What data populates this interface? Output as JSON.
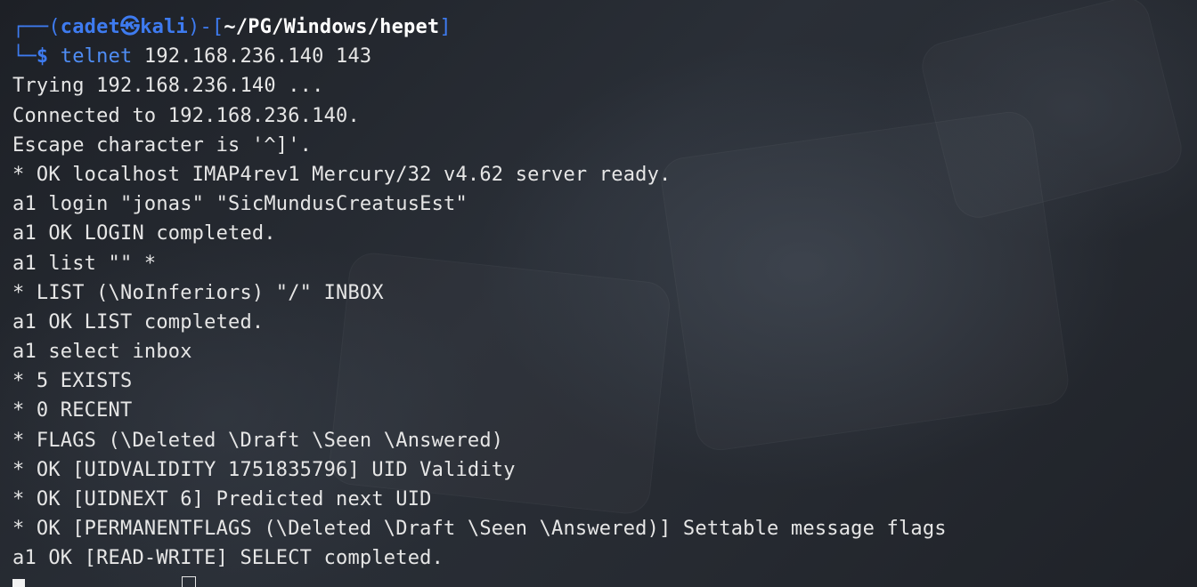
{
  "prompt": {
    "box_top": "┌──(",
    "user": "cadet",
    "at_icon": "㉿",
    "host": "kali",
    "mid": ")-[",
    "path": "~/PG/Windows/hepet",
    "close": "]",
    "box_bottom": "└─",
    "dollar": "$"
  },
  "command": {
    "name": "telnet",
    "args": " 192.168.236.140 143"
  },
  "output": [
    "Trying 192.168.236.140 ...",
    "Connected to 192.168.236.140.",
    "Escape character is '^]'.",
    "* OK localhost IMAP4rev1 Mercury/32 v4.62 server ready.",
    "a1 login \"jonas\" \"SicMundusCreatusEst\"",
    "a1 OK LOGIN completed.",
    "a1 list \"\" *",
    "* LIST (\\NoInferiors) \"/\" INBOX",
    "a1 OK LIST completed.",
    "a1 select inbox",
    "* 5 EXISTS",
    "* 0 RECENT",
    "* FLAGS (\\Deleted \\Draft \\Seen \\Answered)",
    "* OK [UIDVALIDITY 1751835796] UID Validity",
    "* OK [UIDNEXT 6] Predicted next UID",
    "* OK [PERMANENTFLAGS (\\Deleted \\Draft \\Seen \\Answered)] Settable message flags",
    "a1 OK [READ-WRITE] SELECT completed."
  ],
  "colors": {
    "prompt": "#3e7bf0",
    "path": "#ffffff",
    "text": "#e6e6e6",
    "background": "#23272e"
  }
}
